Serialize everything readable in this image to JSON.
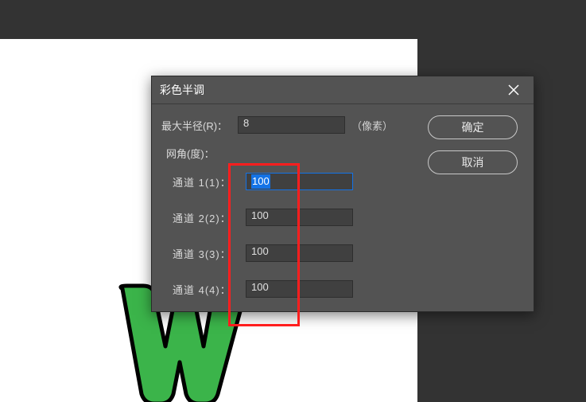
{
  "dialog": {
    "title": "彩色半调",
    "max_radius_label": "最大半径(R)：",
    "max_radius_value": "8",
    "unit": "（像素）",
    "screen_angle_label": "网角(度)：",
    "channels": [
      {
        "label": "通道 1(1)：",
        "value": "100"
      },
      {
        "label": "通道 2(2)：",
        "value": "100"
      },
      {
        "label": "通道 3(3)：",
        "value": "100"
      },
      {
        "label": "通道 4(4)：",
        "value": "100"
      }
    ],
    "ok_label": "确定",
    "cancel_label": "取消"
  }
}
